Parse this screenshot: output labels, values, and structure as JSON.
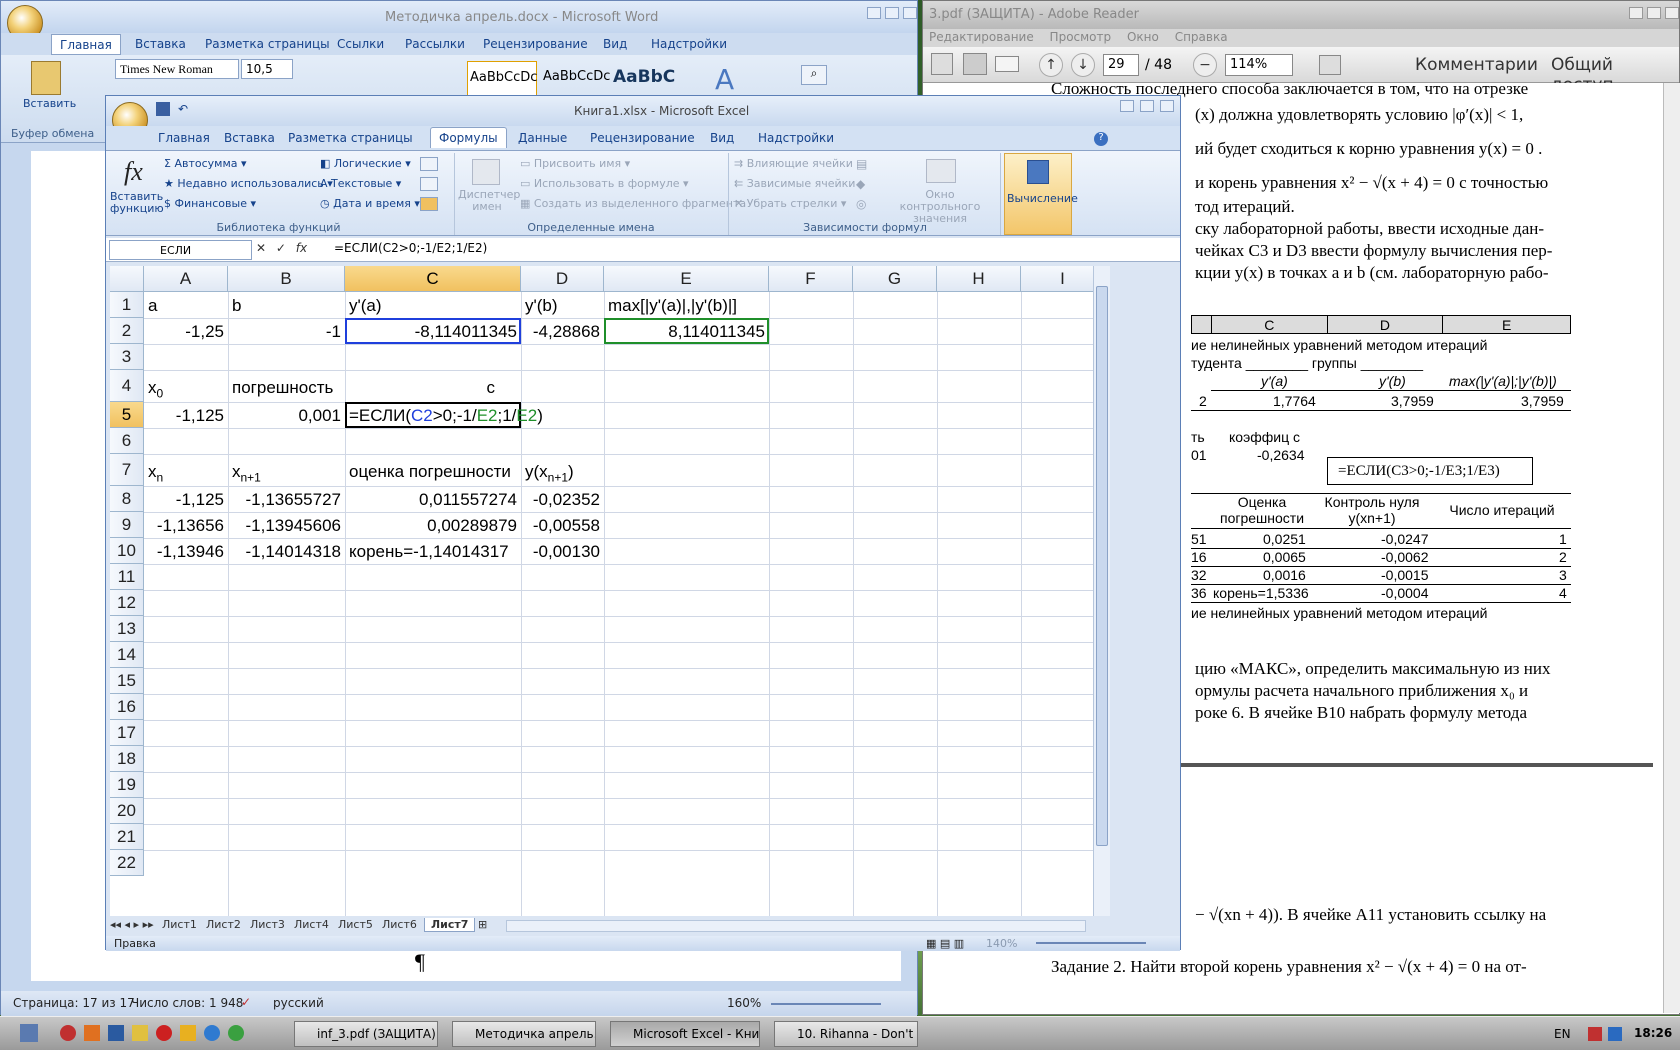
{
  "reader": {
    "title": "3.pdf (ЗАЩИТА) - Adobe Reader",
    "menu": [
      "Редактирование",
      "Просмотр",
      "Окно",
      "Справка"
    ],
    "page_number": "29",
    "page_total": "/ 48",
    "zoom": "114%",
    "comments": "Комментарии",
    "share": "Общий доступ",
    "lines": [
      "Сложность последнего способа заключается в том, что на отрезке",
      "(x)  должна удовлетворять  условию  |φ′(x)| < 1,",
      "ий будет сходиться к корню уравнения  y(x) = 0 .",
      "и корень уравнения  x² − √(x + 4) = 0  с точностью",
      "тод итераций.",
      "ску лабораторной работы, ввести исходные дан-",
      "чейках C3 и D3 ввести формулу вычисления пер-",
      "кции y(x) в точках a и b (см. лабораторную рабо-"
    ],
    "table": {
      "headers": [
        "C",
        "D",
        "E"
      ],
      "caption1": "ие нелинейных уравнений  методом итераций",
      "caption2": "тудента ________ группы ________",
      "row_h": [
        "y'(a)",
        "y'(b)",
        "max(|y'(a)|;|y'(b)|)"
      ],
      "row_v": [
        "2",
        "1,7764",
        "3,7959",
        "3,7959"
      ],
      "row_k_label": "ть",
      "coef_label": "коэффиц c",
      "coef_left": "01",
      "coef_val": "-0,2634",
      "tooltip": "=ЕСЛИ(C3>0;-1/E3;1/E3)",
      "head2": [
        "Оценка погрешности",
        "Контроль нуля y(xn+1)",
        "Число итераций"
      ],
      "rows": [
        [
          "51",
          "0,0251",
          "-0,0247",
          "1"
        ],
        [
          "16",
          "0,0065",
          "-0,0062",
          "2"
        ],
        [
          "32",
          "0,0016",
          "-0,0015",
          "3"
        ],
        [
          "36",
          "корень=1,5336",
          "-0,0004",
          "4"
        ]
      ],
      "footer": "ие нелинейных уравнений методом итераций"
    },
    "lines2": [
      "цию «МАКС», определить максимальную из них",
      "ормулы расчета начального приближения x₀ и",
      "роке 6. В ячейке B10 набрать формулу метода"
    ],
    "lines3": [
      "− √(xn + 4)). В ячейке A11 установить ссылку на",
      "Задание 2. Найти второй корень уравнения  x² − √(x + 4) = 0  на от-"
    ]
  },
  "word": {
    "title": "Методичка апрель.docx - Microsoft Word",
    "tabs": [
      "Главная",
      "Вставка",
      "Разметка страницы",
      "Ссылки",
      "Рассылки",
      "Рецензирование",
      "Вид",
      "Надстройки"
    ],
    "font": "Times New Roman",
    "size": "10,5",
    "paste": "Вставить",
    "clipboard": "Буфер обмена",
    "styles": [
      "AaBbCcDc",
      "AaBbCcDc",
      "AaBbC"
    ],
    "pilcrow": "¶",
    "status_page": "Страница: 17 из 17",
    "status_words": "Число слов: 1 948",
    "status_lang": "русский",
    "zoom": "160%"
  },
  "excel": {
    "title": "Книга1.xlsx - Microsoft Excel",
    "tabs": [
      "Главная",
      "Вставка",
      "Разметка страницы",
      "Формулы",
      "Данные",
      "Рецензирование",
      "Вид",
      "Надстройки"
    ],
    "active_tab": "Формулы",
    "ribbon": {
      "insert_fn": "Вставить функцию",
      "autosum": "Автосумма",
      "recent": "Недавно использовались",
      "financial": "Финансовые",
      "logical": "Логические",
      "text": "Текстовые",
      "datetime": "Дата и время",
      "group1": "Библиотека функций",
      "name_mgr": "Диспетчер имен",
      "assign_name": "Присвоить имя",
      "use_in_formula": "Использовать в формуле",
      "create_from_sel": "Создать из выделенного фрагмента",
      "group2": "Определенные имена",
      "trace_prec": "Влияющие ячейки",
      "trace_dep": "Зависимые ячейки",
      "remove_arrows": "Убрать стрелки",
      "watch": "Окно контрольного значения",
      "group3": "Зависимости формул",
      "calc": "Вычисление"
    },
    "namebox": "ЕСЛИ",
    "formula": "=ЕСЛИ(C2>0;-1/E2;1/E2)",
    "cols": [
      "A",
      "B",
      "C",
      "D",
      "E",
      "F",
      "G",
      "H",
      "I"
    ],
    "rows": [
      "1",
      "2",
      "3",
      "4",
      "5",
      "6",
      "7",
      "8",
      "9",
      "10",
      "11",
      "12",
      "13",
      "14",
      "15",
      "16",
      "17",
      "18",
      "19",
      "20",
      "21",
      "22"
    ],
    "cells": {
      "A1": "a",
      "B1": "b",
      "C1": "y'(a)",
      "D1": "y'(b)",
      "E1": "max[|y'(a)|,|y'(b)|]",
      "A2": "-1,25",
      "B2": "-1",
      "C2": "-8,114011345",
      "D2": "-4,28868",
      "E2": "8,114011345",
      "A4": "x",
      "A4sub": "0",
      "B4": "погрешность",
      "C4": "c",
      "A5": "-1,125",
      "B5": "0,001",
      "A7": "x",
      "A7sub": "n",
      "B7": "x",
      "B7sub": "n+1",
      "C7": "оценка погрешности",
      "D7": "y(x",
      "D7sub": "n+1",
      "D7end": ")",
      "A8": "-1,125",
      "B8": "-1,13655727",
      "C8": "0,011557274",
      "D8": "-0,02352",
      "A9": "-1,13656",
      "B9": "-1,13945606",
      "C9": "0,00289879",
      "D9": "-0,00558",
      "A10": "-1,13946",
      "B10": "-1,14014318",
      "C10": "корень=-1,14014317",
      "D10": "-0,00130"
    },
    "c5_formula": {
      "p1": "=ЕСЛИ(",
      "r1": "C2",
      "p2": ">0;-1/",
      "r2": "E2",
      "p3": ";1/",
      "r3": "E2",
      "p4": ")"
    },
    "sheets": [
      "Лист1",
      "Лист2",
      "Лист3",
      "Лист4",
      "Лист5",
      "Лист6",
      "Лист7"
    ],
    "active_sheet": "Лист7",
    "status": "Правка",
    "zoom": "140%"
  },
  "taskbar": {
    "buttons": [
      "inf_3.pdf (ЗАЩИТА) -...",
      "Методичка апрель.do...",
      "Microsoft Excel - Книг...",
      "10. Rihanna - Don't St..."
    ],
    "lang": "EN",
    "time": "18:26"
  },
  "colors": {
    "excel_ref_blue": "#1f3fdc",
    "excel_ref_green": "#1f8f2a",
    "selection": "#f1c15f"
  }
}
